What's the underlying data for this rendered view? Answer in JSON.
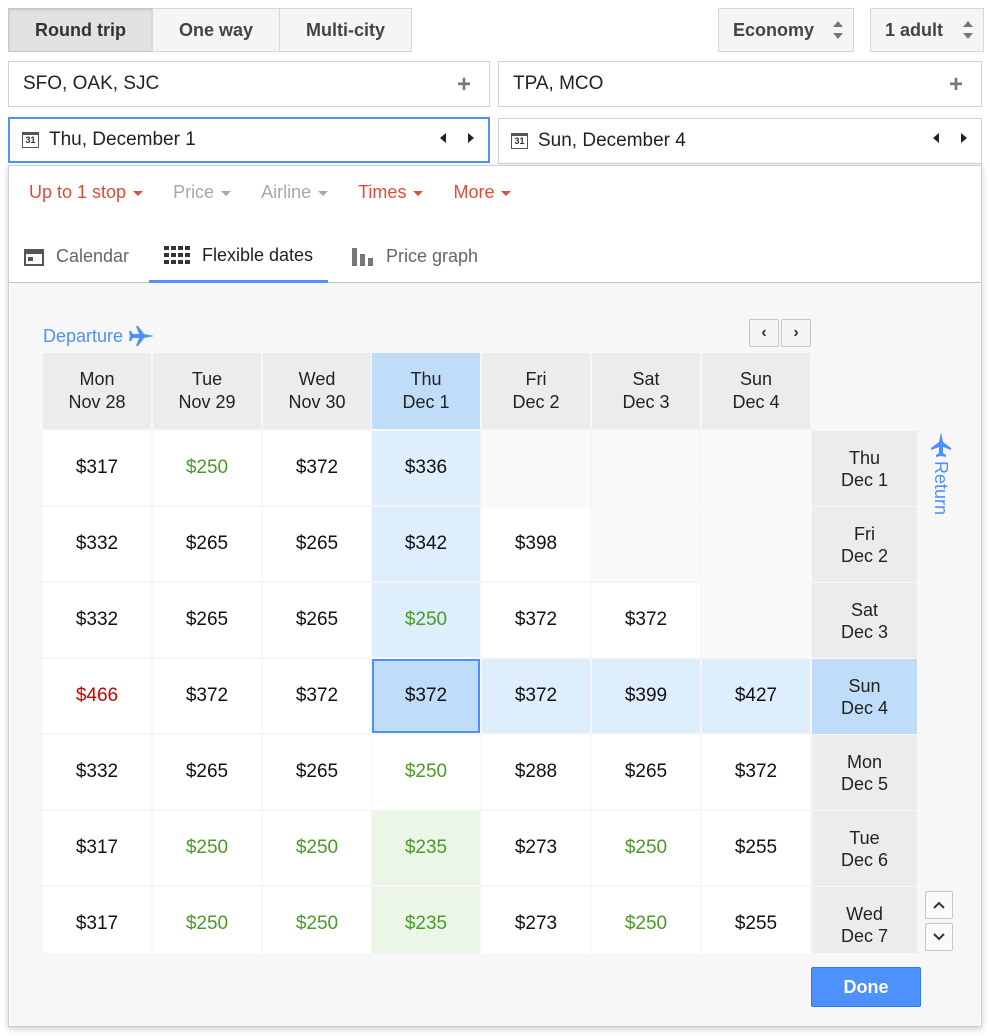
{
  "trip_types": [
    {
      "label": "Round trip",
      "active": true
    },
    {
      "label": "One way",
      "active": false
    },
    {
      "label": "Multi-city",
      "active": false
    }
  ],
  "cabin": {
    "value": "Economy"
  },
  "passengers": {
    "value": "1 adult"
  },
  "origin": {
    "value": "SFO, OAK, SJC",
    "icon": "plus-icon"
  },
  "destination": {
    "value": "TPA, MCO",
    "icon": "plus-icon"
  },
  "depart_date": {
    "value": "Thu, December 1",
    "icon": "calendar-icon"
  },
  "return_date": {
    "value": "Sun, December 4",
    "icon": "calendar-icon"
  },
  "filters": [
    {
      "label": "Up to 1 stop",
      "state": "active"
    },
    {
      "label": "Price",
      "state": "disabled"
    },
    {
      "label": "Airline",
      "state": "disabled"
    },
    {
      "label": "Times",
      "state": "active"
    },
    {
      "label": "More",
      "state": "active"
    }
  ],
  "view_tabs": [
    {
      "label": "Calendar",
      "icon": "calendar-icon",
      "active": false
    },
    {
      "label": "Flexible dates",
      "icon": "grid-icon",
      "active": true
    },
    {
      "label": "Price graph",
      "icon": "bar-chart-icon",
      "active": false
    }
  ],
  "departure_label": "Departure",
  "return_label": "Return",
  "departure_dates": [
    {
      "day": "Mon",
      "date": "Nov 28"
    },
    {
      "day": "Tue",
      "date": "Nov 29"
    },
    {
      "day": "Wed",
      "date": "Nov 30"
    },
    {
      "day": "Thu",
      "date": "Dec 1"
    },
    {
      "day": "Fri",
      "date": "Dec 2"
    },
    {
      "day": "Sat",
      "date": "Dec 3"
    },
    {
      "day": "Sun",
      "date": "Dec 4"
    }
  ],
  "return_dates": [
    {
      "day": "Thu",
      "date": "Dec 1"
    },
    {
      "day": "Fri",
      "date": "Dec 2"
    },
    {
      "day": "Sat",
      "date": "Dec 3"
    },
    {
      "day": "Sun",
      "date": "Dec 4"
    },
    {
      "day": "Mon",
      "date": "Dec 5"
    },
    {
      "day": "Tue",
      "date": "Dec 6"
    },
    {
      "day": "Wed",
      "date": "Dec 7"
    }
  ],
  "selected": {
    "departure_index": 3,
    "return_index": 3
  },
  "price_grid": [
    [
      "$317",
      "$250",
      "$372",
      "$336",
      "",
      "",
      ""
    ],
    [
      "$332",
      "$265",
      "$265",
      "$342",
      "$398",
      "",
      ""
    ],
    [
      "$332",
      "$265",
      "$265",
      "$250",
      "$372",
      "$372",
      ""
    ],
    [
      "$466",
      "$372",
      "$372",
      "$372",
      "$372",
      "$399",
      "$427"
    ],
    [
      "$332",
      "$265",
      "$265",
      "$250",
      "$288",
      "$265",
      "$372"
    ],
    [
      "$317",
      "$250",
      "$250",
      "$235",
      "$273",
      "$250",
      "$255"
    ],
    [
      "$317",
      "$250",
      "$250",
      "$235",
      "$273",
      "$250",
      "$255"
    ]
  ],
  "price_colors": {
    "low": "#4a9a27",
    "high": "#cc0000",
    "normal": "#111111",
    "accent": "#4d90fe",
    "filter_active": "#dd4b39"
  },
  "done_label": "Done"
}
